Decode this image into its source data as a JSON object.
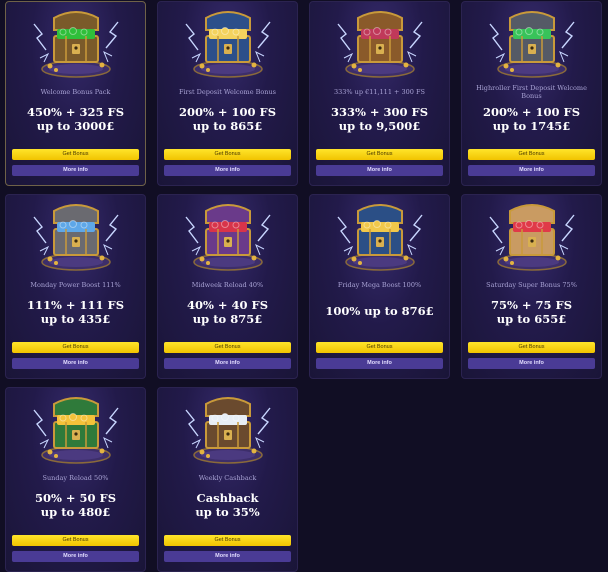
{
  "cards": [
    {
      "name": "Welcome Bonus Pack",
      "line1": "450% + 325 FS",
      "line2": "up to 3000£",
      "get": "Get Bonus",
      "more": "More info",
      "chest": "green-treasure-chest-icon",
      "gem_color": "#2fbf3a",
      "wood_color": "#7a5a2a"
    },
    {
      "name": "First Deposit Welcome Bonus",
      "line1": "200% + 100 FS",
      "line2": "up to 865£",
      "get": "Get Bonus",
      "more": "More info",
      "chest": "blue-gold-treasure-chest-icon",
      "gem_color": "#f4d35e",
      "wood_color": "#2c4f8a"
    },
    {
      "name": "333% up €11,111 + 300 FS",
      "line1": "333% + 300 FS",
      "line2": "up to 9,500£",
      "get": "Get Bonus",
      "more": "More info",
      "chest": "purple-treasure-chest-icon",
      "gem_color": "#c0395a",
      "wood_color": "#8a5a2a"
    },
    {
      "name": "Highroller First Deposit Welcome Bonus",
      "line1": "200% + 100 FS",
      "line2": "up to 1745£",
      "get": "Get Bonus",
      "more": "More info",
      "chest": "silver-treasure-chest-icon",
      "gem_color": "#38c35a",
      "wood_color": "#555a66"
    },
    {
      "name": "Monday Power Boost 111%",
      "line1": "111% + 111 FS",
      "line2": "up to 435£",
      "get": "Get Bonus",
      "more": "More info",
      "chest": "blue-gem-treasure-chest-icon",
      "gem_color": "#5ea7e8",
      "wood_color": "#6a6a70"
    },
    {
      "name": "Midweek Reload 40%",
      "line1": "40% + 40 FS",
      "line2": "up to 875£",
      "get": "Get Bonus",
      "more": "More info",
      "chest": "red-gem-treasure-chest-icon",
      "gem_color": "#d8344a",
      "wood_color": "#6a3a8a"
    },
    {
      "name": "Friday Mega Boost 100%",
      "line1": "100% up to 876£",
      "line2": "",
      "get": "Get Bonus",
      "more": "More info",
      "chest": "gold-blue-treasure-chest-icon",
      "gem_color": "#f1c84a",
      "wood_color": "#2b4f86"
    },
    {
      "name": "Saturday Super Bonus 75%",
      "line1": "75% + 75 FS",
      "line2": "up to 655£",
      "get": "Get Bonus",
      "more": "More info",
      "chest": "ruby-treasure-chest-icon",
      "gem_color": "#e03a48",
      "wood_color": "#c99b62"
    },
    {
      "name": "Sunday Reload 50%",
      "line1": "50% + 50 FS",
      "line2": "up to 480£",
      "get": "Get Bonus",
      "more": "More info",
      "chest": "green-gold-treasure-chest-icon",
      "gem_color": "#f4c23a",
      "wood_color": "#2f7a3a"
    },
    {
      "name": "Weekly Cashback",
      "line1": "Cashback",
      "line2": "up to 35%",
      "get": "Get Bonus",
      "more": "More info",
      "chest": "diamond-treasure-chest-icon",
      "gem_color": "#e8eef5",
      "wood_color": "#6a4a2e"
    }
  ],
  "colors": {
    "background": "#110e24",
    "button_get": "#f1c300",
    "button_more": "#4a3b95",
    "lightning": "#c8d6ff"
  }
}
